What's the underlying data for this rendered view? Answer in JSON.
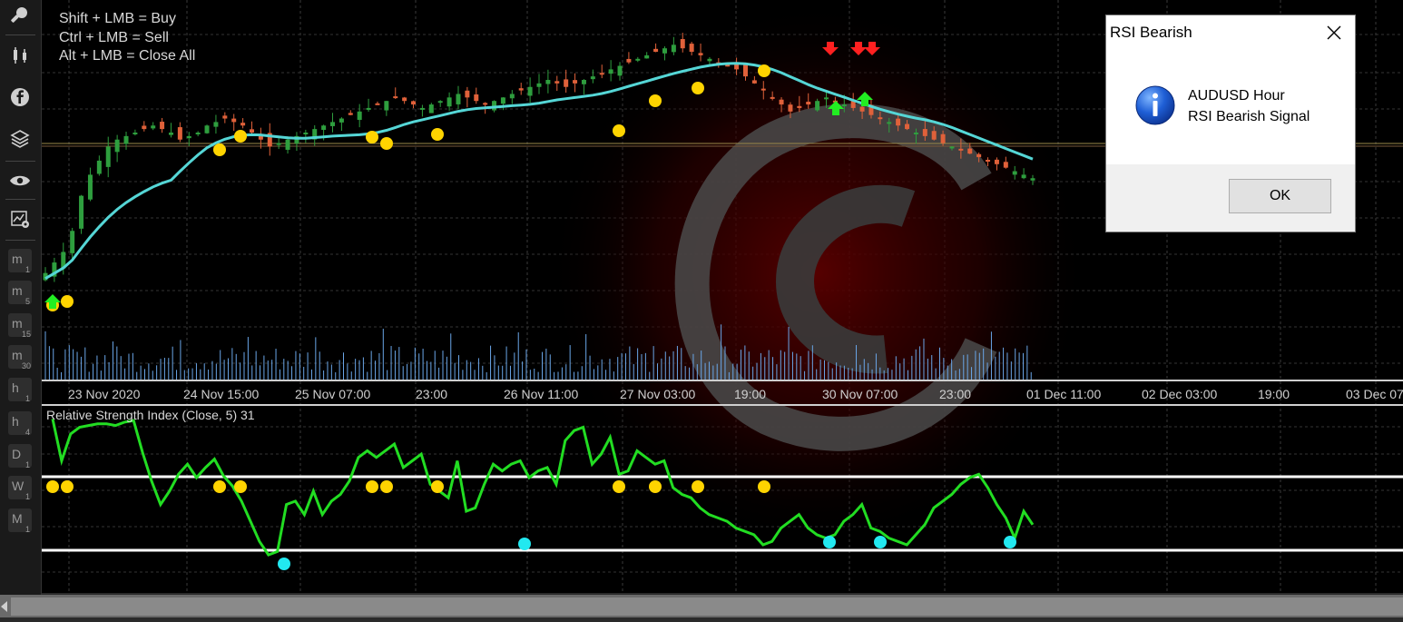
{
  "hotkeys": [
    "Shift + LMB = Buy",
    "Ctrl + LMB = Sell",
    "Alt + LMB = Close All"
  ],
  "toolbar": {
    "timeframes": [
      {
        "letter": "m",
        "sub": "1"
      },
      {
        "letter": "m",
        "sub": "5"
      },
      {
        "letter": "m",
        "sub": "15"
      },
      {
        "letter": "m",
        "sub": "30"
      },
      {
        "letter": "h",
        "sub": "1"
      },
      {
        "letter": "h",
        "sub": "4"
      },
      {
        "letter": "D",
        "sub": "1"
      },
      {
        "letter": "W",
        "sub": "1"
      },
      {
        "letter": "M",
        "sub": "1"
      }
    ]
  },
  "time_axis": [
    "23 Nov 2020",
    "24 Nov 15:00",
    "25 Nov 07:00",
    "23:00",
    "26 Nov 11:00",
    "27 Nov 03:00",
    "19:00",
    "30 Nov 07:00",
    "23:00",
    "01 Dec 11:00",
    "02 Dec 03:00",
    "19:00",
    "03 Dec 07"
  ],
  "indicator": {
    "title": "Relative Strength Index (Close, 5) 31"
  },
  "dialog": {
    "title": "RSI Bearish",
    "icon": "info-icon",
    "message_line1": "AUDUSD Hour",
    "message_line2": "RSI Bearish Signal",
    "ok_label": "OK"
  },
  "colors": {
    "bull_candle": "#2e9e3e",
    "bear_candle": "#e0613a",
    "moving_average": "#55d6d6",
    "rsi_line": "#22dd22",
    "signal_dot_yellow": "#ffd400",
    "signal_dot_cyan": "#22e8f0",
    "sell_arrow": "#ff2020",
    "buy_arrow": "#22ee22",
    "volume": "#6aa6e8"
  },
  "chart_data": {
    "type": "line",
    "symbol": "AUDUSD",
    "timeframe": "Hour",
    "rsi_period": 5,
    "rsi_current": 31,
    "rsi_levels": [
      70,
      30
    ],
    "rsi_series": [
      95,
      70,
      86,
      90,
      91,
      92,
      92,
      91,
      93,
      94,
      75,
      58,
      44,
      52,
      62,
      68,
      60,
      66,
      71,
      61,
      55,
      46,
      34,
      22,
      14,
      16,
      44,
      46,
      38,
      52,
      38,
      46,
      50,
      58,
      72,
      76,
      72,
      76,
      80,
      66,
      70,
      74,
      56,
      52,
      48,
      70,
      40,
      42,
      56,
      68,
      64,
      68,
      70,
      60,
      64,
      66,
      56,
      82,
      88,
      90,
      68,
      74,
      84,
      62,
      64,
      76,
      72,
      68,
      70,
      54,
      50,
      48,
      42,
      38,
      36,
      34,
      30,
      28,
      26,
      20,
      22,
      30,
      34,
      38,
      30,
      26,
      24,
      26,
      34,
      38,
      44,
      30,
      28,
      24,
      22,
      20,
      26,
      32,
      42,
      46,
      50,
      56,
      60,
      62,
      54,
      44,
      36,
      24,
      40,
      32
    ],
    "price_close": [
      30,
      33,
      36,
      42,
      52,
      58,
      62,
      66,
      68,
      69,
      70,
      71,
      72,
      71,
      70,
      68,
      69,
      70,
      72,
      73,
      74,
      73,
      72,
      70,
      68,
      66,
      67,
      68,
      69,
      70,
      71,
      72,
      73,
      74,
      75,
      76,
      77,
      78,
      79,
      80,
      79,
      78,
      77,
      78,
      79,
      80,
      81,
      80,
      79,
      78,
      79,
      80,
      81,
      82,
      83,
      84,
      85,
      84,
      83,
      84,
      85,
      86,
      87,
      88,
      89,
      90,
      91,
      92,
      93,
      94,
      95,
      94,
      93,
      92,
      91,
      90,
      89,
      88,
      86,
      84,
      82,
      80,
      78,
      76,
      77,
      78,
      79,
      80,
      79,
      78,
      77,
      76,
      75,
      74,
      73,
      72,
      71,
      70,
      69,
      68,
      67,
      66,
      65,
      64,
      63,
      62,
      61,
      60,
      59,
      58,
      57
    ],
    "markers": {
      "sell_arrows": 3,
      "buy_arrows": 3
    }
  }
}
